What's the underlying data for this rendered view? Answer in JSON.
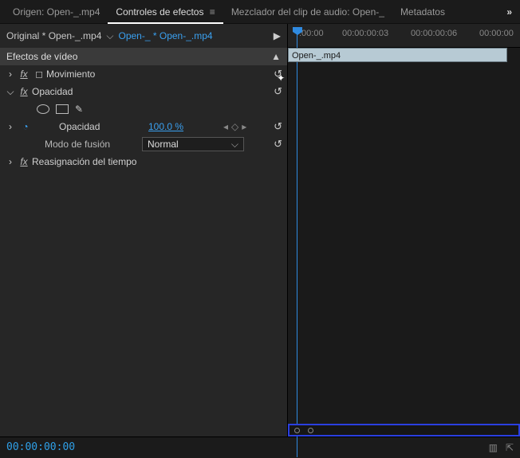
{
  "tabs": {
    "source": "Origen: Open-_.mp4",
    "effect_controls": "Controles de efectos",
    "audio_mixer": "Mezclador del clip de audio: Open-_",
    "metadata": "Metadatos"
  },
  "source_row": {
    "original_prefix": "Original * ",
    "original_file": "Open-_.mp4",
    "sequence": "Open-_ * Open-_.mp4"
  },
  "video_effects_header": "Efectos de vídeo",
  "effects": {
    "motion": "Movimiento",
    "opacity": "Opacidad",
    "opacity_param": "Opacidad",
    "opacity_value": "100.0 %",
    "blend_mode_label": "Modo de fusión",
    "blend_mode_value": "Normal",
    "time_remap": "Reasignación del tiempo"
  },
  "timeline": {
    "ticks": [
      ":00:00",
      "00:00:00:03",
      "00:00:00:06",
      "00:00:00"
    ],
    "clip_name": "Open-_.mp4"
  },
  "status": {
    "timecode": "00:00:00:00"
  }
}
